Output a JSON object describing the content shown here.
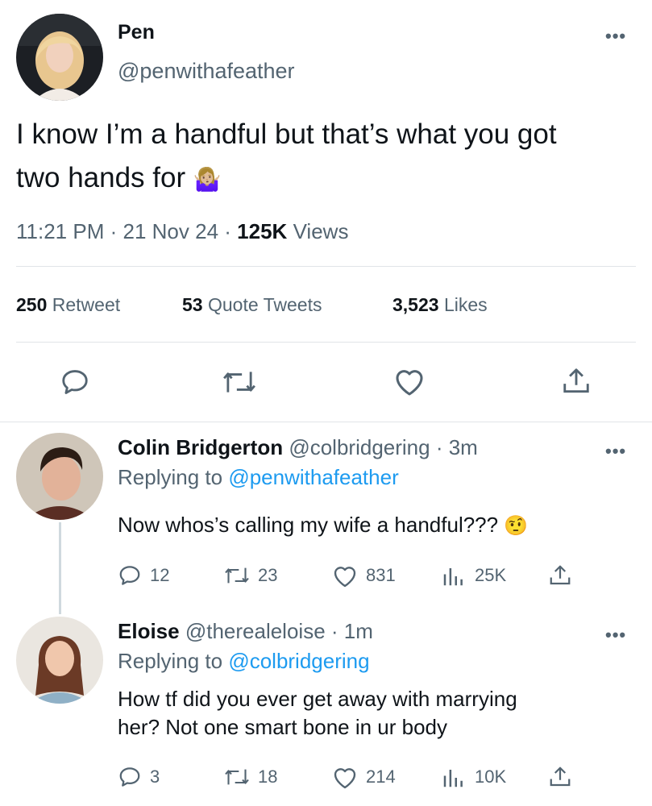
{
  "main_tweet": {
    "display_name": "Pen",
    "handle": "@penwithafeather",
    "text_line1": "I know I’m a handful but that’s what you got",
    "text_line2": "two hands for",
    "emoji": "🤷🏼‍♀️",
    "time": "11:21 PM",
    "date": "21 Nov 24",
    "views_count": "125K",
    "views_label": "Views",
    "separator": "·",
    "retweets_count": "250",
    "retweets_label": "Retweet",
    "quotes_count": "53",
    "quotes_label": "Quote Tweets",
    "likes_count": "3,523",
    "likes_label": "Likes"
  },
  "replies": [
    {
      "display_name": "Colin Bridgerton",
      "handle": "@colbridgering",
      "time": "· 3m",
      "replying_prefix": "Replying to",
      "replying_handle": "@penwithafeather",
      "text_line1": "Now whos’s calling my wife a handful???",
      "text_line2": "",
      "emoji": "🤨",
      "reply_count": "12",
      "retweet_count": "23",
      "like_count": "831",
      "view_count": "25K"
    },
    {
      "display_name": "Eloise",
      "handle": "@therealeloise",
      "time": "· 1m",
      "replying_prefix": "Replying to",
      "replying_handle": "@colbridgering",
      "text_line1": "How tf did you ever get away with marrying",
      "text_line2": "her? Not one smart bone in ur body",
      "emoji": "",
      "reply_count": "3",
      "retweet_count": "18",
      "like_count": "214",
      "view_count": "10K"
    }
  ],
  "icons": {
    "more": "more-horizontal-icon",
    "reply": "reply-bubble-icon",
    "retweet": "retweet-icon",
    "like": "heart-icon",
    "share": "share-upload-icon",
    "views": "analytics-bar-icon"
  },
  "colors": {
    "link": "#1d9bf0",
    "muted": "#536471",
    "text": "#0f1419",
    "divider": "#e1e4e8"
  }
}
